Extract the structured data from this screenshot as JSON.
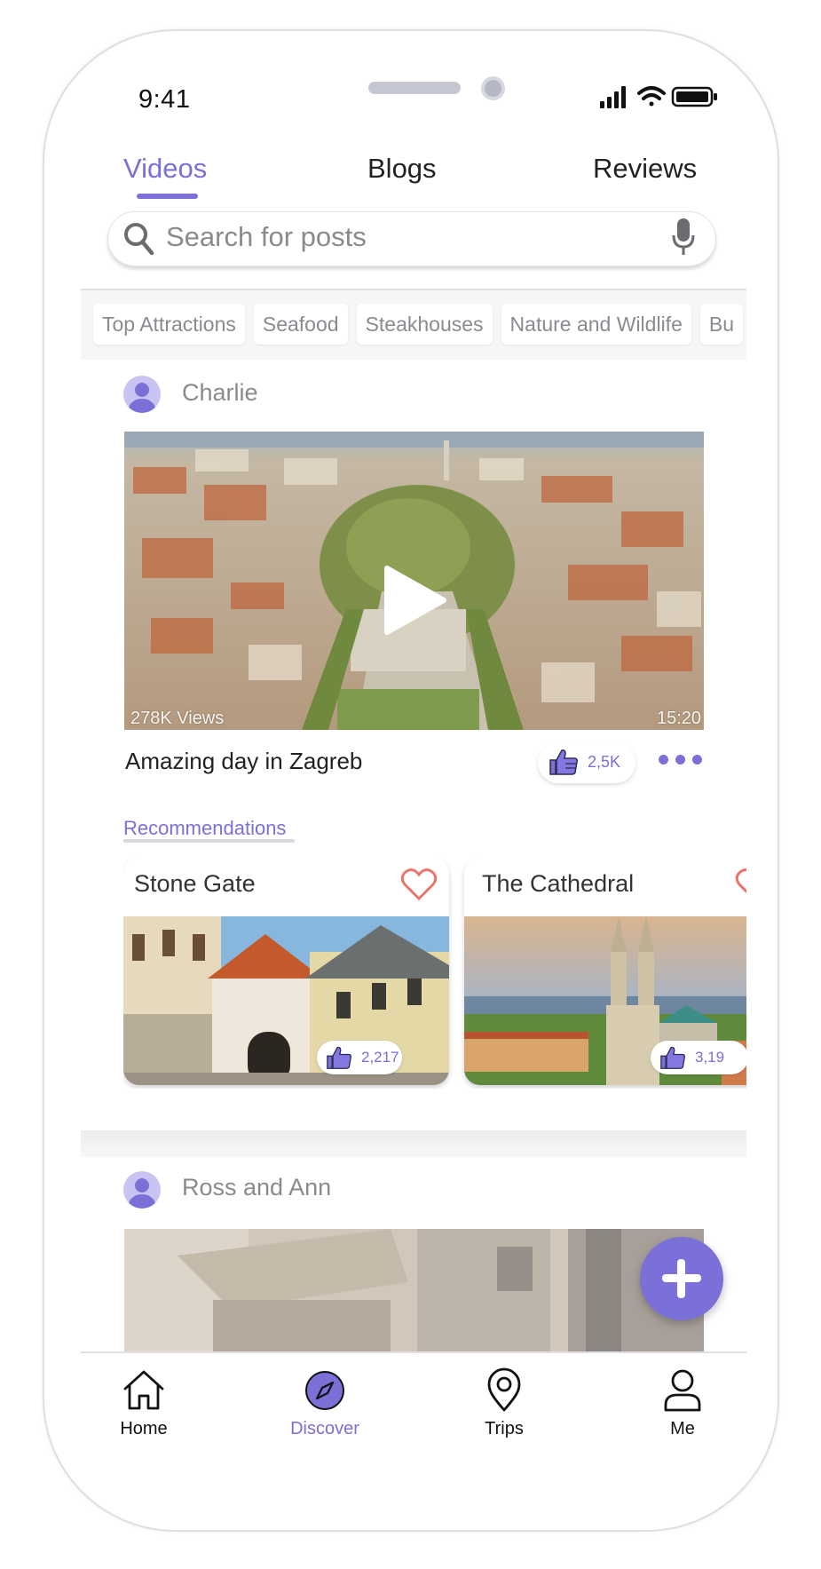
{
  "status_bar": {
    "time": "9:41"
  },
  "tabs": [
    {
      "label": "Videos",
      "active": true
    },
    {
      "label": "Blogs",
      "active": false
    },
    {
      "label": "Reviews",
      "active": false
    }
  ],
  "search": {
    "placeholder": "Search for posts"
  },
  "categories": [
    "Top Attractions",
    "Seafood",
    "Steakhouses",
    "Nature and Wildlife",
    "Bu"
  ],
  "posts": [
    {
      "author": "Charlie",
      "views": "278K Views",
      "duration": "15:20",
      "title": "Amazing day in Zagreb",
      "likes": "2,5K"
    },
    {
      "author": "Ross and Ann"
    }
  ],
  "recommendations": {
    "label": "Recommendations",
    "items": [
      {
        "title": "Stone Gate",
        "likes": "2,217"
      },
      {
        "title": "The Cathedral",
        "likes": "3,19"
      }
    ]
  },
  "bottom_nav": [
    {
      "label": "Home",
      "icon": "home-icon",
      "active": false
    },
    {
      "label": "Discover",
      "icon": "compass-icon",
      "active": true
    },
    {
      "label": "Trips",
      "icon": "map-pin-icon",
      "active": false
    },
    {
      "label": "Me",
      "icon": "user-icon",
      "active": false
    }
  ],
  "colors": {
    "accent": "#7b6fd8",
    "heart": "#e8766c"
  }
}
